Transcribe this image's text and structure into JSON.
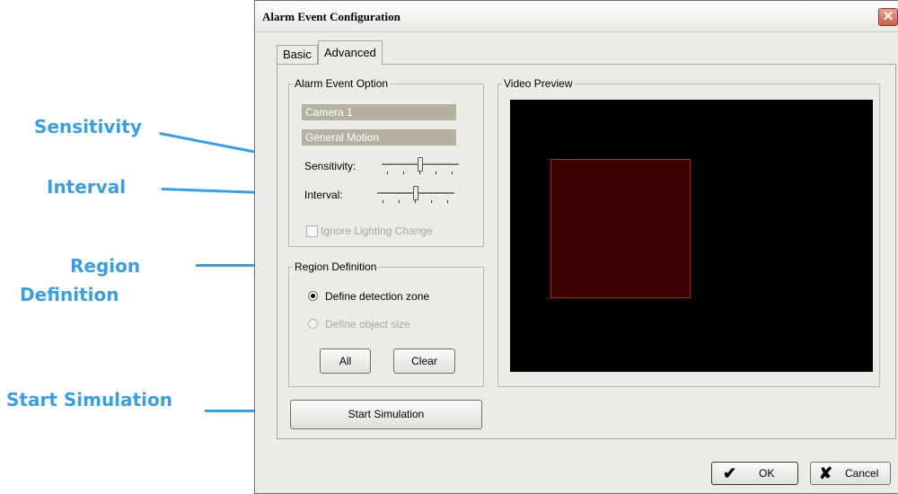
{
  "annotations": {
    "sensitivity": "Sensitivity",
    "interval": "Interval",
    "region_line1": "Region",
    "region_line2": "Definition",
    "start_simulation": "Start Simulation"
  },
  "dialog": {
    "title": "Alarm Event Configuration",
    "close_glyph": "✕"
  },
  "tabs": [
    {
      "label": "Basic",
      "active": false
    },
    {
      "label": "Advanced",
      "active": true
    }
  ],
  "alarm_event_option": {
    "legend": "Alarm Event Option",
    "camera": "Camera 1",
    "event_type": "General Motion",
    "sensitivity_label": "Sensitivity:",
    "sensitivity_value": 0.5,
    "interval_label": "Interval:",
    "interval_value": 0.5,
    "ignore_lighting_label": "Ignore Lighting Change",
    "ignore_lighting_checked": false
  },
  "region_definition": {
    "legend": "Region Definition",
    "option_zone": "Define detection zone",
    "option_object": "Define object size",
    "selected": "zone",
    "all_label": "All",
    "clear_label": "Clear"
  },
  "video_preview": {
    "legend": "Video Preview",
    "background": "#000000",
    "zone_fill": "#3a0000",
    "zone_border": "#c0201c"
  },
  "start_simulation_label": "Start Simulation",
  "footer": {
    "ok_label": "OK",
    "cancel_label": "Cancel",
    "ok_icon": "checkmark-icon",
    "cancel_icon": "x-icon"
  },
  "colors": {
    "annotation": "#3b9ee0",
    "dialog_bg": "#ecebe6"
  }
}
